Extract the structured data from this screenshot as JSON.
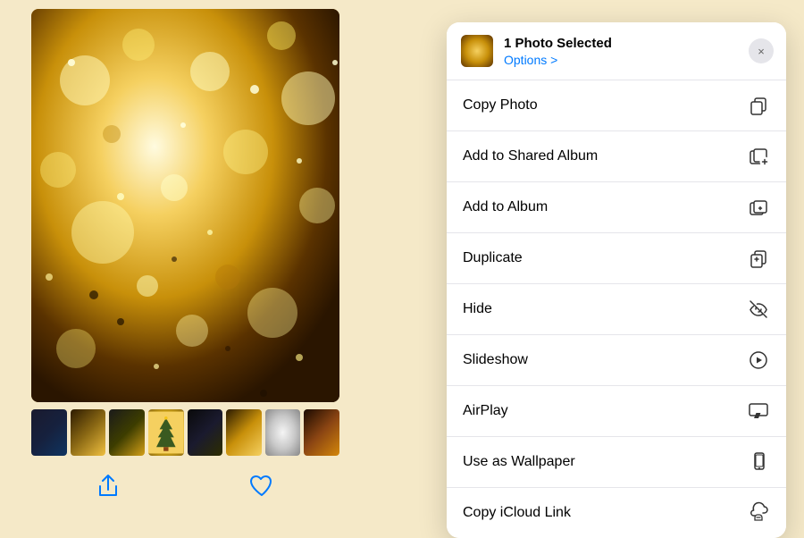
{
  "background_color": "#f5e9c8",
  "photo_area": {
    "main_photo_alt": "Golden bokeh photo",
    "thumbnails": [
      {
        "id": 1,
        "alt": "Dark blue sparkle"
      },
      {
        "id": 2,
        "alt": "Gold bokeh"
      },
      {
        "id": 3,
        "alt": "Dark gold"
      },
      {
        "id": 4,
        "alt": "Christmas tree gold"
      },
      {
        "id": 5,
        "alt": "Dark night"
      },
      {
        "id": 6,
        "alt": "Warm gold"
      },
      {
        "id": 7,
        "alt": "Silver bokeh"
      },
      {
        "id": 8,
        "alt": "Warm dark"
      }
    ],
    "share_button_label": "Share",
    "favorite_button_label": "Favorite"
  },
  "context_menu": {
    "header": {
      "title": "1 Photo Selected",
      "options_label": "Options >",
      "close_label": "×"
    },
    "items": [
      {
        "id": "copy-photo",
        "label": "Copy Photo",
        "icon": "copy"
      },
      {
        "id": "add-shared-album",
        "label": "Add to Shared Album",
        "icon": "shared-album"
      },
      {
        "id": "add-album",
        "label": "Add to Album",
        "icon": "album"
      },
      {
        "id": "duplicate",
        "label": "Duplicate",
        "icon": "duplicate"
      },
      {
        "id": "hide",
        "label": "Hide",
        "icon": "hide"
      },
      {
        "id": "slideshow",
        "label": "Slideshow",
        "icon": "slideshow"
      },
      {
        "id": "airplay",
        "label": "AirPlay",
        "icon": "airplay"
      },
      {
        "id": "use-as-wallpaper",
        "label": "Use as Wallpaper",
        "icon": "wallpaper"
      },
      {
        "id": "copy-icloud-link",
        "label": "Copy iCloud Link",
        "icon": "icloud"
      }
    ]
  }
}
